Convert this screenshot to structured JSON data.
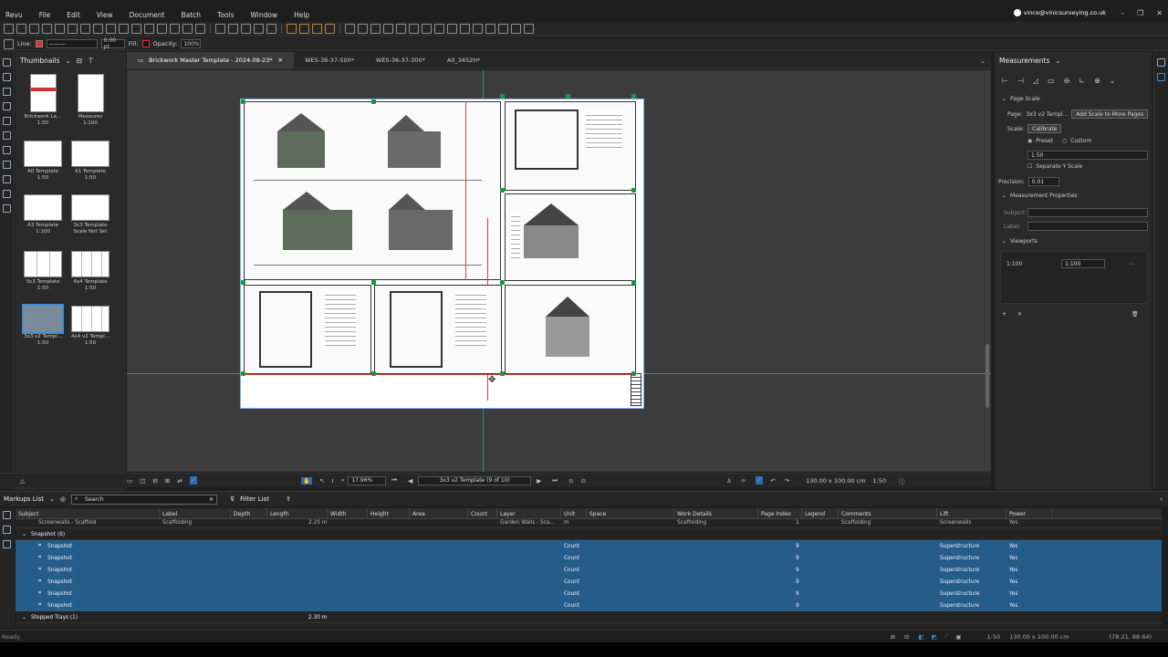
{
  "app": {
    "name": "Revu"
  },
  "menu": [
    "Revu",
    "File",
    "Edit",
    "View",
    "Document",
    "Batch",
    "Tools",
    "Window",
    "Help"
  ],
  "account": "vince@vinicsurveying.co.uk",
  "props_bar": {
    "line_label": "Line:",
    "width_value": "0.00 pt",
    "fill_label": "Fill:",
    "opacity_label": "Opacity:",
    "opacity_value": "100%"
  },
  "thumbnails": {
    "title": "Thumbnails",
    "items": [
      {
        "name": "Brickwork La...",
        "scale": "1:50"
      },
      {
        "name": "Measures",
        "scale": "1:100"
      },
      {
        "name": "A0 Template",
        "scale": "1:50"
      },
      {
        "name": "A1 Template",
        "scale": "1:50"
      },
      {
        "name": "A3 Template",
        "scale": "1:100"
      },
      {
        "name": "3x3 Template",
        "scale": "Scale Not Set"
      },
      {
        "name": "3x3 Template",
        "scale": "1:50"
      },
      {
        "name": "4x4 Template",
        "scale": "1:50"
      },
      {
        "name": "3x3 v2 Templ...",
        "scale": "1:50"
      },
      {
        "name": "4x4 v2 Templ...",
        "scale": "1:50"
      }
    ]
  },
  "tabs": [
    {
      "label": "Brickwork Master Template - 2024-08-23*",
      "active": true
    },
    {
      "label": "WES-36-37-500*"
    },
    {
      "label": "WES-36-37-300*"
    },
    {
      "label": "A0_3452H*"
    }
  ],
  "canvas_status": {
    "zoom": "17.96%",
    "page": "3x3 v2 Template (9 of 10)",
    "size": "130.00 x 100.00 cm",
    "scale": "1:50"
  },
  "measurements": {
    "title": "Measurements",
    "page_scale_header": "Page Scale",
    "page_label": "Page:",
    "page_value": "3x3 v2 Templ...",
    "add_scale_btn": "Add Scale to More Pages",
    "scale_label": "Scale:",
    "calibrate_btn": "Calibrate",
    "preset_label": "Preset",
    "custom_label": "Custom",
    "scale_value": "1:50",
    "separate_y": "Separate Y Scale",
    "precision_label": "Precision:",
    "precision_value": "0.01",
    "props_header": "Measurement Properties",
    "subject_label": "Subject:",
    "label_label": "Label:",
    "viewports_header": "Viewports",
    "viewport_name": "1:100",
    "viewport_scale": "1:100"
  },
  "markups": {
    "title": "Markups List",
    "search_placeholder": "Search",
    "filter_label": "Filter List",
    "columns": [
      "Subject",
      "Label",
      "Depth",
      "Length",
      "Width",
      "Height",
      "Area",
      "Count",
      "Layer",
      "Unit",
      "Space",
      "Work Details",
      "Page Index",
      "Legend",
      "Comments",
      "Lift",
      "Power"
    ],
    "top_row": {
      "subject": "Screenwalls - Scaffold",
      "label": "Scaffolding",
      "length": "2.20 m",
      "layer": "Garden Walls - Sca...",
      "unit": "m",
      "work": "Scaffolding",
      "page": "1",
      "comments": "Scaffolding",
      "lift": "Screenwalls",
      "power": "Yes"
    },
    "group1": "Snapshot (6)",
    "snap_rows": [
      {
        "subject": "Snapshot",
        "unit": "Count",
        "page": "9",
        "lift": "Superstructure",
        "power": "Yes"
      },
      {
        "subject": "Snapshot",
        "unit": "Count",
        "page": "9",
        "lift": "Superstructure",
        "power": "Yes"
      },
      {
        "subject": "Snapshot",
        "unit": "Count",
        "page": "9",
        "lift": "Superstructure",
        "power": "Yes"
      },
      {
        "subject": "Snapshot",
        "unit": "Count",
        "page": "9",
        "lift": "Superstructure",
        "power": "Yes"
      },
      {
        "subject": "Snapshot",
        "unit": "Count",
        "page": "9",
        "lift": "Superstructure",
        "power": "Yes"
      },
      {
        "subject": "Snapshot",
        "unit": "Count",
        "page": "9",
        "lift": "Superstructure",
        "power": "Yes"
      }
    ],
    "group2": "Stepped Trays (1)",
    "group2_length": "2.30 m"
  },
  "status": {
    "left": "Ready",
    "scale": "1:50",
    "size": "130.00 x 100.00 cm",
    "coords": "(78.21, 88.64)"
  }
}
